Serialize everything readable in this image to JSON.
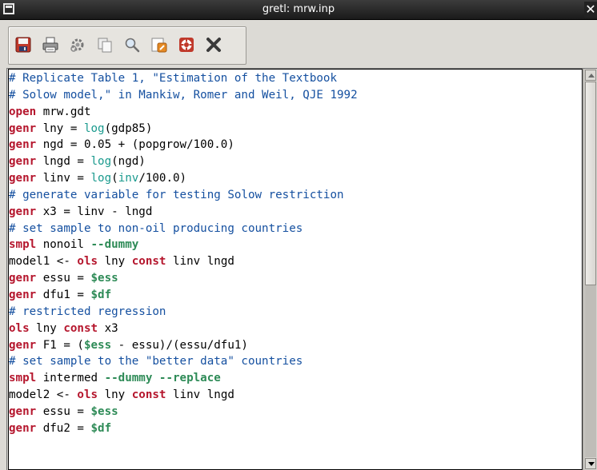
{
  "window": {
    "title": "gretl: mrw.inp",
    "close_glyph": "✕"
  },
  "toolbar": {
    "buttons": [
      {
        "name": "save-icon",
        "color": "#c0392b"
      },
      {
        "name": "print-icon",
        "color": "#555555"
      },
      {
        "name": "execute-icon",
        "color": "#777777"
      },
      {
        "name": "copy-icon",
        "color": "#8a8a8a"
      },
      {
        "name": "find-icon",
        "color": "#5a7fa8"
      },
      {
        "name": "edit-icon",
        "color": "#e07b20"
      },
      {
        "name": "help-icon",
        "color": "#c0392b"
      },
      {
        "name": "close-icon",
        "color": "#444444"
      }
    ]
  },
  "colors": {
    "comment": "#1550a0",
    "keyword": "#b5162d",
    "function": "#1a9a8e",
    "accessor": "#2e8b57"
  },
  "code": {
    "lines": [
      [
        {
          "t": "comment",
          "v": "# Replicate Table 1, \"Estimation of the Textbook"
        }
      ],
      [
        {
          "t": "comment",
          "v": "# Solow model,\" in Mankiw, Romer and Weil, QJE 1992"
        }
      ],
      [
        {
          "t": "kw",
          "v": "open"
        },
        {
          "t": "plain",
          "v": " mrw.gdt"
        }
      ],
      [
        {
          "t": "kw",
          "v": "genr"
        },
        {
          "t": "plain",
          "v": " lny = "
        },
        {
          "t": "fn",
          "v": "log"
        },
        {
          "t": "plain",
          "v": "(gdp85)"
        }
      ],
      [
        {
          "t": "kw",
          "v": "genr"
        },
        {
          "t": "plain",
          "v": " ngd = 0.05 + (popgrow/100.0)"
        }
      ],
      [
        {
          "t": "kw",
          "v": "genr"
        },
        {
          "t": "plain",
          "v": " lngd = "
        },
        {
          "t": "fn",
          "v": "log"
        },
        {
          "t": "plain",
          "v": "(ngd)"
        }
      ],
      [
        {
          "t": "kw",
          "v": "genr"
        },
        {
          "t": "plain",
          "v": " linv = "
        },
        {
          "t": "fn",
          "v": "log"
        },
        {
          "t": "plain",
          "v": "("
        },
        {
          "t": "fn",
          "v": "inv"
        },
        {
          "t": "plain",
          "v": "/100.0)"
        }
      ],
      [
        {
          "t": "comment",
          "v": "# generate variable for testing Solow restriction"
        }
      ],
      [
        {
          "t": "kw",
          "v": "genr"
        },
        {
          "t": "plain",
          "v": " x3 = linv - lngd"
        }
      ],
      [
        {
          "t": "comment",
          "v": "# set sample to non-oil producing countries"
        }
      ],
      [
        {
          "t": "kw",
          "v": "smpl"
        },
        {
          "t": "plain",
          "v": " nonoil "
        },
        {
          "t": "var",
          "v": "--dummy"
        }
      ],
      [
        {
          "t": "plain",
          "v": "model1 <- "
        },
        {
          "t": "kw",
          "v": "ols"
        },
        {
          "t": "plain",
          "v": " lny "
        },
        {
          "t": "kw",
          "v": "const"
        },
        {
          "t": "plain",
          "v": " linv lngd"
        }
      ],
      [
        {
          "t": "kw",
          "v": "genr"
        },
        {
          "t": "plain",
          "v": " essu = "
        },
        {
          "t": "var",
          "v": "$ess"
        }
      ],
      [
        {
          "t": "kw",
          "v": "genr"
        },
        {
          "t": "plain",
          "v": " dfu1 = "
        },
        {
          "t": "var",
          "v": "$df"
        }
      ],
      [
        {
          "t": "comment",
          "v": "# restricted regression"
        }
      ],
      [
        {
          "t": "kw",
          "v": "ols"
        },
        {
          "t": "plain",
          "v": " lny "
        },
        {
          "t": "kw",
          "v": "const"
        },
        {
          "t": "plain",
          "v": " x3"
        }
      ],
      [
        {
          "t": "kw",
          "v": "genr"
        },
        {
          "t": "plain",
          "v": " F1 = ("
        },
        {
          "t": "var",
          "v": "$ess"
        },
        {
          "t": "plain",
          "v": " - essu)/(essu/dfu1)"
        }
      ],
      [
        {
          "t": "comment",
          "v": "# set sample to the \"better data\" countries"
        }
      ],
      [
        {
          "t": "kw",
          "v": "smpl"
        },
        {
          "t": "plain",
          "v": " intermed "
        },
        {
          "t": "var",
          "v": "--dummy --replace"
        }
      ],
      [
        {
          "t": "plain",
          "v": "model2 <- "
        },
        {
          "t": "kw",
          "v": "ols"
        },
        {
          "t": "plain",
          "v": " lny "
        },
        {
          "t": "kw",
          "v": "const"
        },
        {
          "t": "plain",
          "v": " linv lngd"
        }
      ],
      [
        {
          "t": "kw",
          "v": "genr"
        },
        {
          "t": "plain",
          "v": " essu = "
        },
        {
          "t": "var",
          "v": "$ess"
        }
      ],
      [
        {
          "t": "kw",
          "v": "genr"
        },
        {
          "t": "plain",
          "v": " dfu2 = "
        },
        {
          "t": "var",
          "v": "$df"
        }
      ]
    ]
  }
}
